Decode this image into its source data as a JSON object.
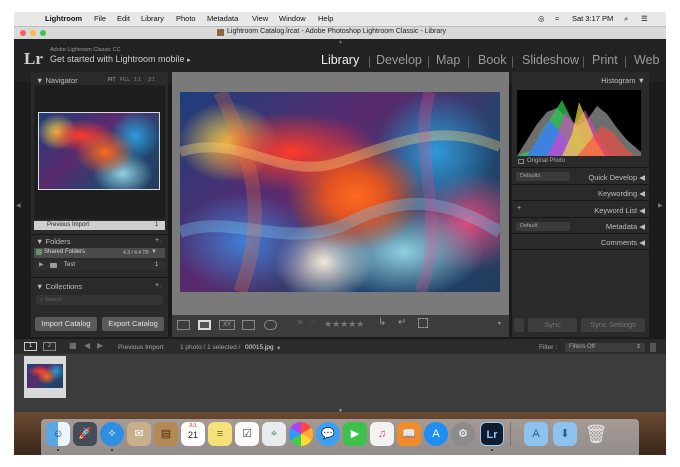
{
  "menubar": {
    "app": "Lightroom",
    "items": [
      "File",
      "Edit",
      "Library",
      "Photo",
      "Metadata",
      "View",
      "Window",
      "Help"
    ],
    "clock": "Sat 3:17 PM"
  },
  "window": {
    "title": "Lightroom Catalog.lrcat - Adobe Photoshop Lightroom Classic - Library"
  },
  "identity": {
    "logo": "Lr",
    "product": "Adobe Lightroom Classic CC",
    "promo": "Get started with Lightroom mobile",
    "promo_arrow": "▸"
  },
  "modules": [
    "Library",
    "Develop",
    "Map",
    "Book",
    "Slideshow",
    "Print",
    "Web"
  ],
  "module_sep": "|",
  "left_panel": {
    "navigator": {
      "title": "Navigator",
      "zoom": [
        "FIT",
        "FILL",
        "1:1",
        "3:1"
      ]
    },
    "previous_import": "Previous Import",
    "previous_import_count": "1",
    "folders": {
      "title": "Folders",
      "add": "+.",
      "volume": "Shared Folders",
      "volume_space": "4.3 / 4.4 TB",
      "folder": "Test",
      "folder_count": "1"
    },
    "collections": {
      "title": "Collections",
      "add": "+.",
      "search_placeholder": "Search"
    },
    "import_button": "Import Catalog",
    "export_button": "Export Catalog"
  },
  "right_panel": {
    "histogram_title": "Histogram",
    "original_photo": "Original Photo",
    "quick_develop": "Quick Develop",
    "quick_develop_preset": "Defaults",
    "keywording": "Keywording",
    "keyword_list": "Keyword List",
    "keyword_add": "+",
    "metadata": "Metadata",
    "metadata_preset": "Default",
    "comments": "Comments",
    "sync_button": "Sync",
    "sync_settings_button": "Sync Settings"
  },
  "toolbar": {
    "rating": "★★★★★"
  },
  "filmstrip_bar": {
    "screen1": "1",
    "screen2": "2",
    "source": "Previous Import",
    "count": "1 photo / 1 selected /",
    "filename": "00015.jpg",
    "filename_arrow": "▾",
    "filter_label": "Filter :",
    "filter_value": "Filters Off"
  },
  "dock": {
    "calendar_month": "JUL",
    "calendar_day": "21",
    "lr_label": "Lr"
  },
  "colors": {
    "lr_bg": "#1b1b1b",
    "panel": "#2a2a2a",
    "text": "#bdbdbd",
    "active_module": "#f2f2f2"
  }
}
